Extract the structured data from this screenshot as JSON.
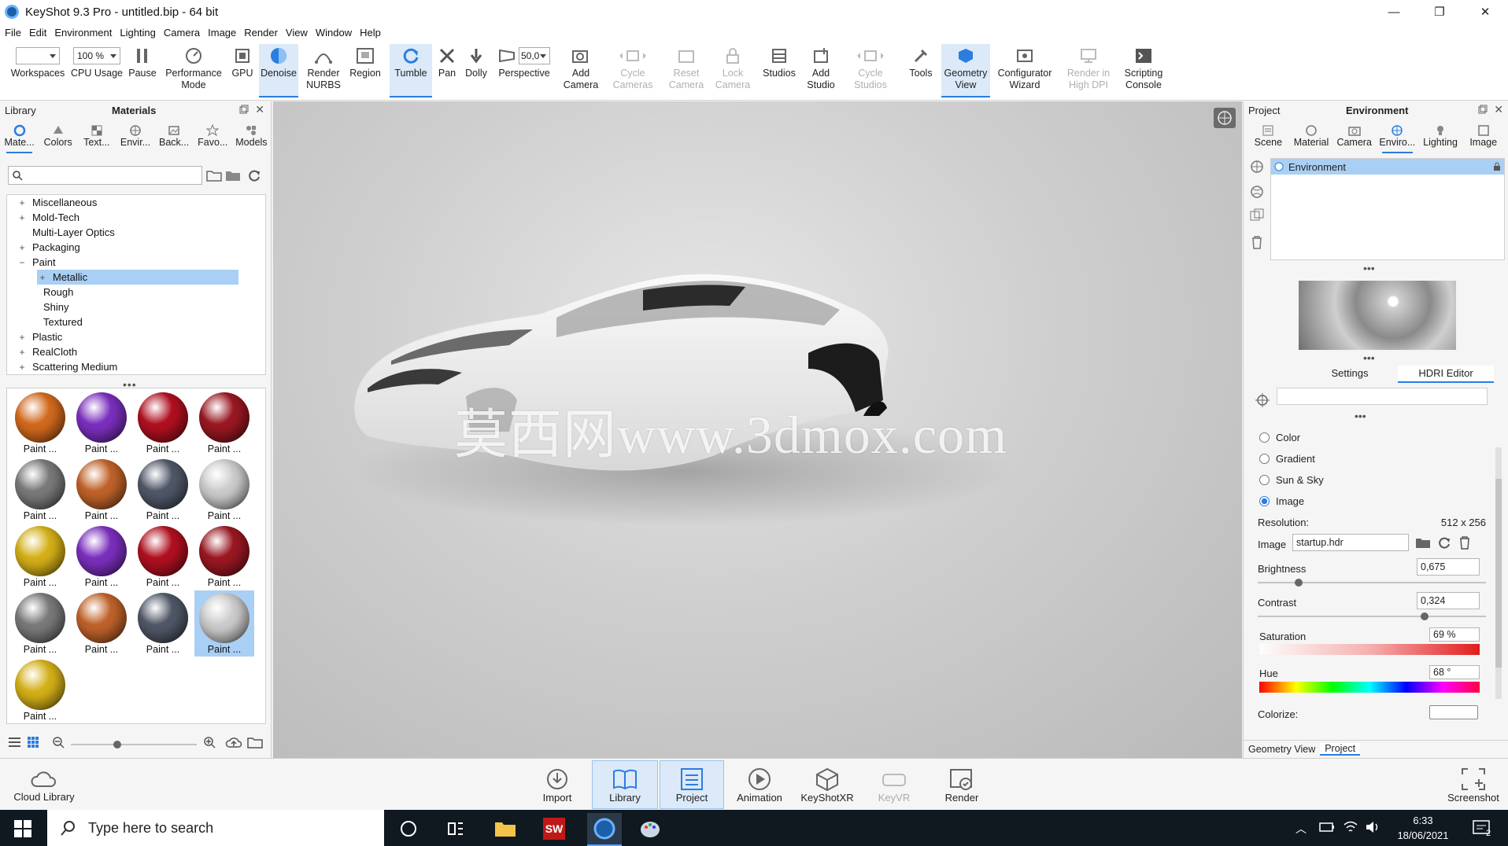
{
  "window": {
    "title": "KeyShot 9.3 Pro  - untitled.bip  - 64 bit",
    "min": "—",
    "max": "❐",
    "close": "✕"
  },
  "menu": [
    "File",
    "Edit",
    "Environment",
    "Lighting",
    "Camera",
    "Image",
    "Render",
    "View",
    "Window",
    "Help"
  ],
  "toolbar": {
    "workspaces": "Workspaces",
    "zoom_value": "100 %",
    "cpu": "CPU Usage",
    "pause": "Pause",
    "performance": "Performance\nMode",
    "gpu": "GPU",
    "denoise": "Denoise",
    "render_nurbs": "Render\nNURBS",
    "region": "Region",
    "tumble": "Tumble",
    "pan": "Pan",
    "dolly": "Dolly",
    "perspective_value": "50,0",
    "perspective": "Perspective",
    "add_camera": "Add\nCamera",
    "cycle_cameras": "Cycle\nCameras",
    "reset_camera": "Reset\nCamera",
    "lock_camera": "Lock\nCamera",
    "studios": "Studios",
    "add_studio": "Add\nStudio",
    "cycle_studios": "Cycle\nStudios",
    "tools": "Tools",
    "geometry_view": "Geometry\nView",
    "configurator": "Configurator\nWizard",
    "render_hidpi": "Render in\nHigh DPI",
    "scripting": "Scripting\nConsole"
  },
  "library": {
    "header": "Library",
    "title": "Materials",
    "tabs": [
      "Mate...",
      "Colors",
      "Text...",
      "Envir...",
      "Back...",
      "Favo...",
      "Models"
    ],
    "tree": [
      {
        "label": "Miscellaneous",
        "pm": "+",
        "indent": 0
      },
      {
        "label": "Mold-Tech",
        "pm": "+",
        "indent": 0
      },
      {
        "label": "Multi-Layer Optics",
        "pm": "",
        "indent": 0
      },
      {
        "label": "Packaging",
        "pm": "+",
        "indent": 0
      },
      {
        "label": "Paint",
        "pm": "−",
        "indent": 0
      },
      {
        "label": "Metallic",
        "pm": "+",
        "indent": 1,
        "selected": true
      },
      {
        "label": "Rough",
        "pm": "",
        "indent": 1
      },
      {
        "label": "Shiny",
        "pm": "",
        "indent": 1
      },
      {
        "label": "Textured",
        "pm": "",
        "indent": 1
      },
      {
        "label": "Plastic",
        "pm": "+",
        "indent": 0
      },
      {
        "label": "RealCloth",
        "pm": "+",
        "indent": 0
      },
      {
        "label": "Scattering Medium",
        "pm": "+",
        "indent": 0
      }
    ],
    "thumbs": [
      {
        "label": "Paint ...",
        "color": "#d2691e"
      },
      {
        "label": "Paint ...",
        "color": "#7b2fbe"
      },
      {
        "label": "Paint ...",
        "color": "#b01020"
      },
      {
        "label": "Paint ...",
        "color": "#9a1822"
      },
      {
        "label": "Paint ...",
        "color": "#7a7a7a"
      },
      {
        "label": "Paint ...",
        "color": "#c0622a"
      },
      {
        "label": "Paint ...",
        "color": "#505868"
      },
      {
        "label": "Paint ...",
        "color": "#cccccc"
      },
      {
        "label": "Paint ...",
        "color": "#d4b018"
      },
      {
        "label": "Paint ...",
        "color": "#7b2fbe"
      },
      {
        "label": "Paint ...",
        "color": "#b01020"
      },
      {
        "label": "Paint ...",
        "color": "#9a1822"
      },
      {
        "label": "Paint ...",
        "color": "#7a7a7a"
      },
      {
        "label": "Paint ...",
        "color": "#c0622a"
      },
      {
        "label": "Paint ...",
        "color": "#505868"
      },
      {
        "label": "Paint ...",
        "color": "#cccccc",
        "selected": true
      },
      {
        "label": "Paint ...",
        "color": "#d4b018"
      }
    ]
  },
  "viewport": {
    "watermark": "莫西网www.3dmox.com"
  },
  "project": {
    "header": "Project",
    "title": "Environment",
    "tabs": [
      "Scene",
      "Material",
      "Camera",
      "Enviro...",
      "Lighting",
      "Image"
    ],
    "env_item": "Environment",
    "subtabs": [
      "Settings",
      "HDRI Editor"
    ],
    "options": [
      "Color",
      "Gradient",
      "Sun & Sky",
      "Image"
    ],
    "selected_option": "Image",
    "resolution_label": "Resolution:",
    "resolution_value": "512 x 256",
    "image_label": "Image",
    "image_value": "startup.hdr",
    "brightness_label": "Brightness",
    "brightness_value": "0,675",
    "brightness_level": 0.18,
    "contrast_label": "Contrast",
    "contrast_value": "0,324",
    "contrast_level": 0.73,
    "saturation_label": "Saturation",
    "saturation_value": "69 %",
    "hue_label": "Hue",
    "hue_value": "68 °",
    "colorize_label": "Colorize:",
    "bottom_tabs": [
      "Geometry View",
      "Project"
    ]
  },
  "bottom": {
    "cloud": "Cloud Library",
    "import": "Import",
    "library": "Library",
    "project": "Project",
    "animation": "Animation",
    "keyshotxr": "KeyShotXR",
    "keyvr": "KeyVR",
    "render": "Render",
    "screenshot": "Screenshot"
  },
  "taskbar": {
    "search_placeholder": "Type here to search",
    "time": "6:33",
    "date": "18/06/2021",
    "notif_count": "2"
  }
}
